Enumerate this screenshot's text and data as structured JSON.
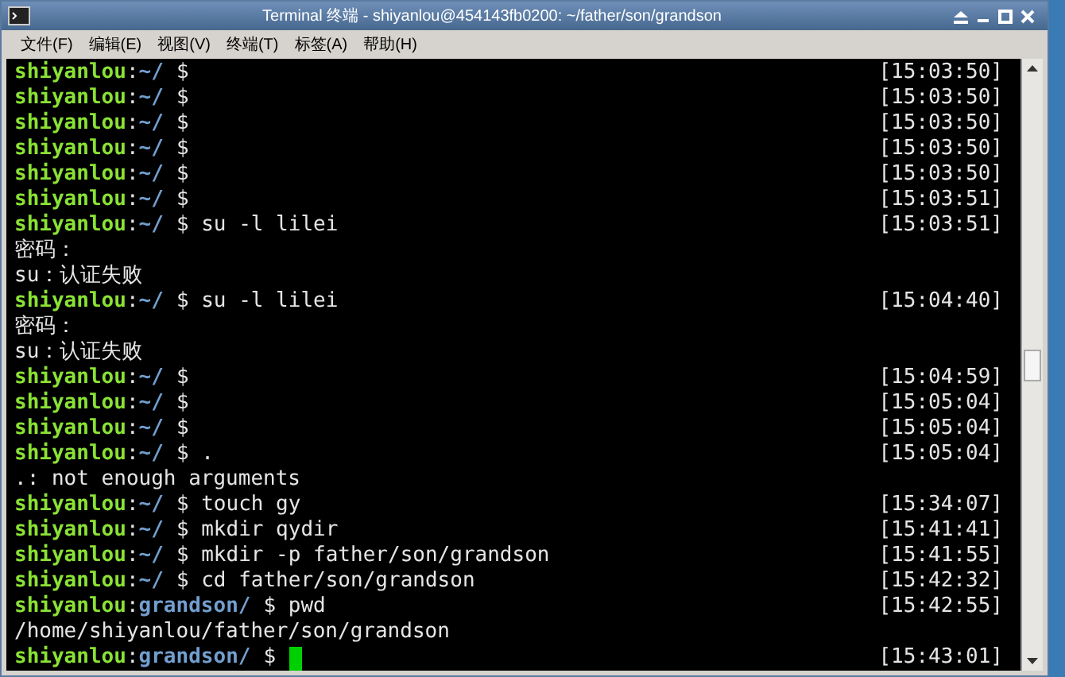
{
  "window": {
    "title": "Terminal 终端 - shiyanlou@454143fb0200: ~/father/son/grandson"
  },
  "menu": [
    "文件(F)",
    "编辑(E)",
    "视图(V)",
    "终端(T)",
    "标签(A)",
    "帮助(H)"
  ],
  "lines": [
    {
      "kind": "prompt",
      "user": "shiyanlou",
      "sep": ":",
      "dir": "~/",
      "command": "$",
      "time": "[15:03:50]"
    },
    {
      "kind": "prompt",
      "user": "shiyanlou",
      "sep": ":",
      "dir": "~/",
      "command": "$",
      "time": "[15:03:50]"
    },
    {
      "kind": "prompt",
      "user": "shiyanlou",
      "sep": ":",
      "dir": "~/",
      "command": "$",
      "time": "[15:03:50]"
    },
    {
      "kind": "prompt",
      "user": "shiyanlou",
      "sep": ":",
      "dir": "~/",
      "command": "$",
      "time": "[15:03:50]"
    },
    {
      "kind": "prompt",
      "user": "shiyanlou",
      "sep": ":",
      "dir": "~/",
      "command": "$",
      "time": "[15:03:50]"
    },
    {
      "kind": "prompt",
      "user": "shiyanlou",
      "sep": ":",
      "dir": "~/",
      "command": "$",
      "time": "[15:03:51]"
    },
    {
      "kind": "prompt",
      "user": "shiyanlou",
      "sep": ":",
      "dir": "~/",
      "command": "$ su -l lilei",
      "time": "[15:03:51]"
    },
    {
      "kind": "output",
      "text": "密码："
    },
    {
      "kind": "output",
      "text": "su：认证失败"
    },
    {
      "kind": "prompt",
      "user": "shiyanlou",
      "sep": ":",
      "dir": "~/",
      "command": "$ su -l lilei",
      "time": "[15:04:40]"
    },
    {
      "kind": "output",
      "text": "密码："
    },
    {
      "kind": "output",
      "text": "su：认证失败"
    },
    {
      "kind": "prompt",
      "user": "shiyanlou",
      "sep": ":",
      "dir": "~/",
      "command": "$",
      "time": "[15:04:59]"
    },
    {
      "kind": "prompt",
      "user": "shiyanlou",
      "sep": ":",
      "dir": "~/",
      "command": "$",
      "time": "[15:05:04]"
    },
    {
      "kind": "prompt",
      "user": "shiyanlou",
      "sep": ":",
      "dir": "~/",
      "command": "$",
      "time": "[15:05:04]"
    },
    {
      "kind": "prompt",
      "user": "shiyanlou",
      "sep": ":",
      "dir": "~/",
      "command": "$ .",
      "time": "[15:05:04]"
    },
    {
      "kind": "output",
      "text": ".: not enough arguments"
    },
    {
      "kind": "prompt",
      "user": "shiyanlou",
      "sep": ":",
      "dir": "~/",
      "command": "$ touch gy",
      "time": "[15:34:07]"
    },
    {
      "kind": "prompt",
      "user": "shiyanlou",
      "sep": ":",
      "dir": "~/",
      "command": "$ mkdir qydir",
      "time": "[15:41:41]"
    },
    {
      "kind": "prompt",
      "user": "shiyanlou",
      "sep": ":",
      "dir": "~/",
      "command": "$ mkdir -p father/son/grandson",
      "time": "[15:41:55]"
    },
    {
      "kind": "prompt",
      "user": "shiyanlou",
      "sep": ":",
      "dir": "~/",
      "command": "$ cd father/son/grandson",
      "time": "[15:42:32]"
    },
    {
      "kind": "prompt",
      "user": "shiyanlou",
      "sep": ":",
      "dir": "grandson/",
      "command": "$ pwd",
      "time": "[15:42:55]"
    },
    {
      "kind": "output",
      "text": "/home/shiyanlou/father/son/grandson"
    },
    {
      "kind": "prompt",
      "user": "shiyanlou",
      "sep": ":",
      "dir": "grandson/",
      "command": "$",
      "time": "[15:43:01]",
      "cursor": true
    }
  ]
}
